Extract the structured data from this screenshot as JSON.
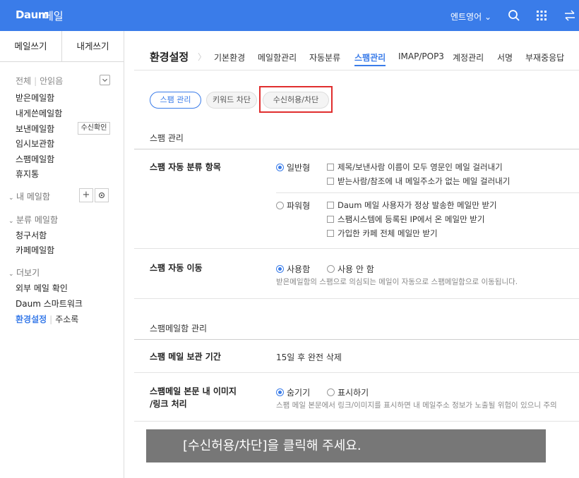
{
  "topbar": {
    "logo": "Daum",
    "app_name": "메일",
    "language": "엔트영어 ⌄",
    "color": "#3a7ce9"
  },
  "sidebar": {
    "tabs": [
      "메일쓰기",
      "내게쓰기"
    ],
    "filter": {
      "all": "전체",
      "unread": "안읽음"
    },
    "items": [
      "받은메일함",
      "내게쓴메일함",
      "보낸메일함",
      "임시보관함",
      "스팸메일함",
      "휴지통"
    ],
    "sent_badge": "수신확인",
    "my_mailbox": "내 메일함",
    "category": {
      "title": "분류 메일함",
      "items": [
        "청구서함",
        "카페메일함"
      ]
    },
    "more": {
      "title": "더보기",
      "items": [
        "외부 메일 확인",
        "Daum 스마트워크"
      ]
    },
    "bottom": {
      "settings": "환경설정",
      "contacts": "주소록"
    }
  },
  "main": {
    "title": "환경설정",
    "nav": [
      "기본환경",
      "메일함관리",
      "자동분류",
      "스팸관리",
      "IMAP/POP3",
      "계정관리",
      "서명",
      "부재중응답"
    ],
    "pills": [
      "스팸 관리",
      "키워드 차단",
      "수신허용/차단"
    ],
    "spam_section": "스팸 관리",
    "auto_classify": {
      "label": "스팸 자동 분류 항목",
      "normal": "일반형",
      "normal_options": [
        "제목/보낸사람 이름이 모두 영문인 메일 걸러내기",
        "받는사람/참조에 내 메일주소가 없는 메일 걸러내기"
      ],
      "power": "파워형",
      "power_options": [
        "Daum 메일 사용자가 정상 발송한 메일만 받기",
        "스팸시스템에 등록된 IP에서 온 메일만 받기",
        "가입한 카페 전체 메일만 받기"
      ]
    },
    "auto_move": {
      "label": "스팸 자동 이동",
      "use": "사용함",
      "no_use": "사용 안 함",
      "desc": "받은메일함의 스팸으로 의심되는 메일이 자동으로 스팸메일함으로 이동됩니다."
    },
    "spambox_section": "스팸메일함 관리",
    "retention": {
      "label": "스팸 메일 보관 기간",
      "value": "15일 후 완전 삭제"
    },
    "image_link": {
      "label_line1": "스팸메일 본문 내 이미지",
      "label_line2": "/링크 처리",
      "hide": "숨기기",
      "show": "표시하기",
      "desc": "스팸 메일 본문에서 링크/이미지를 표시하면 내 메일주소 정보가 노출될 위험이 있으니 주의"
    }
  },
  "tooltip": "[수신허용/차단]을 클릭해 주세요."
}
